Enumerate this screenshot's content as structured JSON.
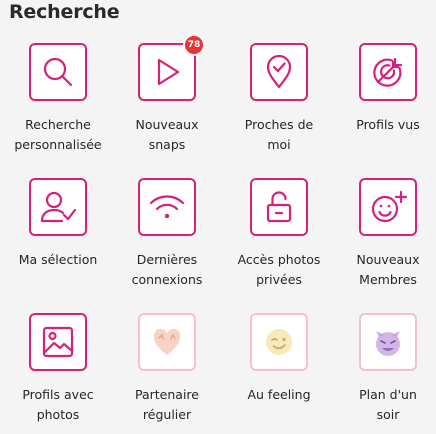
{
  "section": {
    "title": "Recherche"
  },
  "tiles": [
    {
      "label": "Recherche\npersonnalisée",
      "icon": "magnifier-icon"
    },
    {
      "label": "Nouveaux\nsnaps",
      "icon": "play-icon",
      "badge": "78"
    },
    {
      "label": "Proches de\nmoi",
      "icon": "location-pin-icon"
    },
    {
      "label": "Profils vus",
      "icon": "target-arrow-icon"
    },
    {
      "label": "Ma sélection",
      "icon": "user-check-icon"
    },
    {
      "label": "Dernières\nconnexions",
      "icon": "wifi-icon"
    },
    {
      "label": "Accès photos\nprivées",
      "icon": "unlocked-padlock-icon"
    },
    {
      "label": "Nouveaux\nMembres",
      "icon": "smiley-plus-icon"
    },
    {
      "label": "Profils avec\nphotos",
      "icon": "picture-icon"
    },
    {
      "label": "Partenaire\nrégulier",
      "icon": "heart-hands-emoji"
    },
    {
      "label": "Au feeling",
      "icon": "winking-face-emoji"
    },
    {
      "label": "Plan d'un\nsoir",
      "icon": "smiling-devil-emoji"
    }
  ],
  "colors": {
    "accent": "#d6217b",
    "accent_soft": "#f3c1d6",
    "badge": "#e3353b"
  }
}
